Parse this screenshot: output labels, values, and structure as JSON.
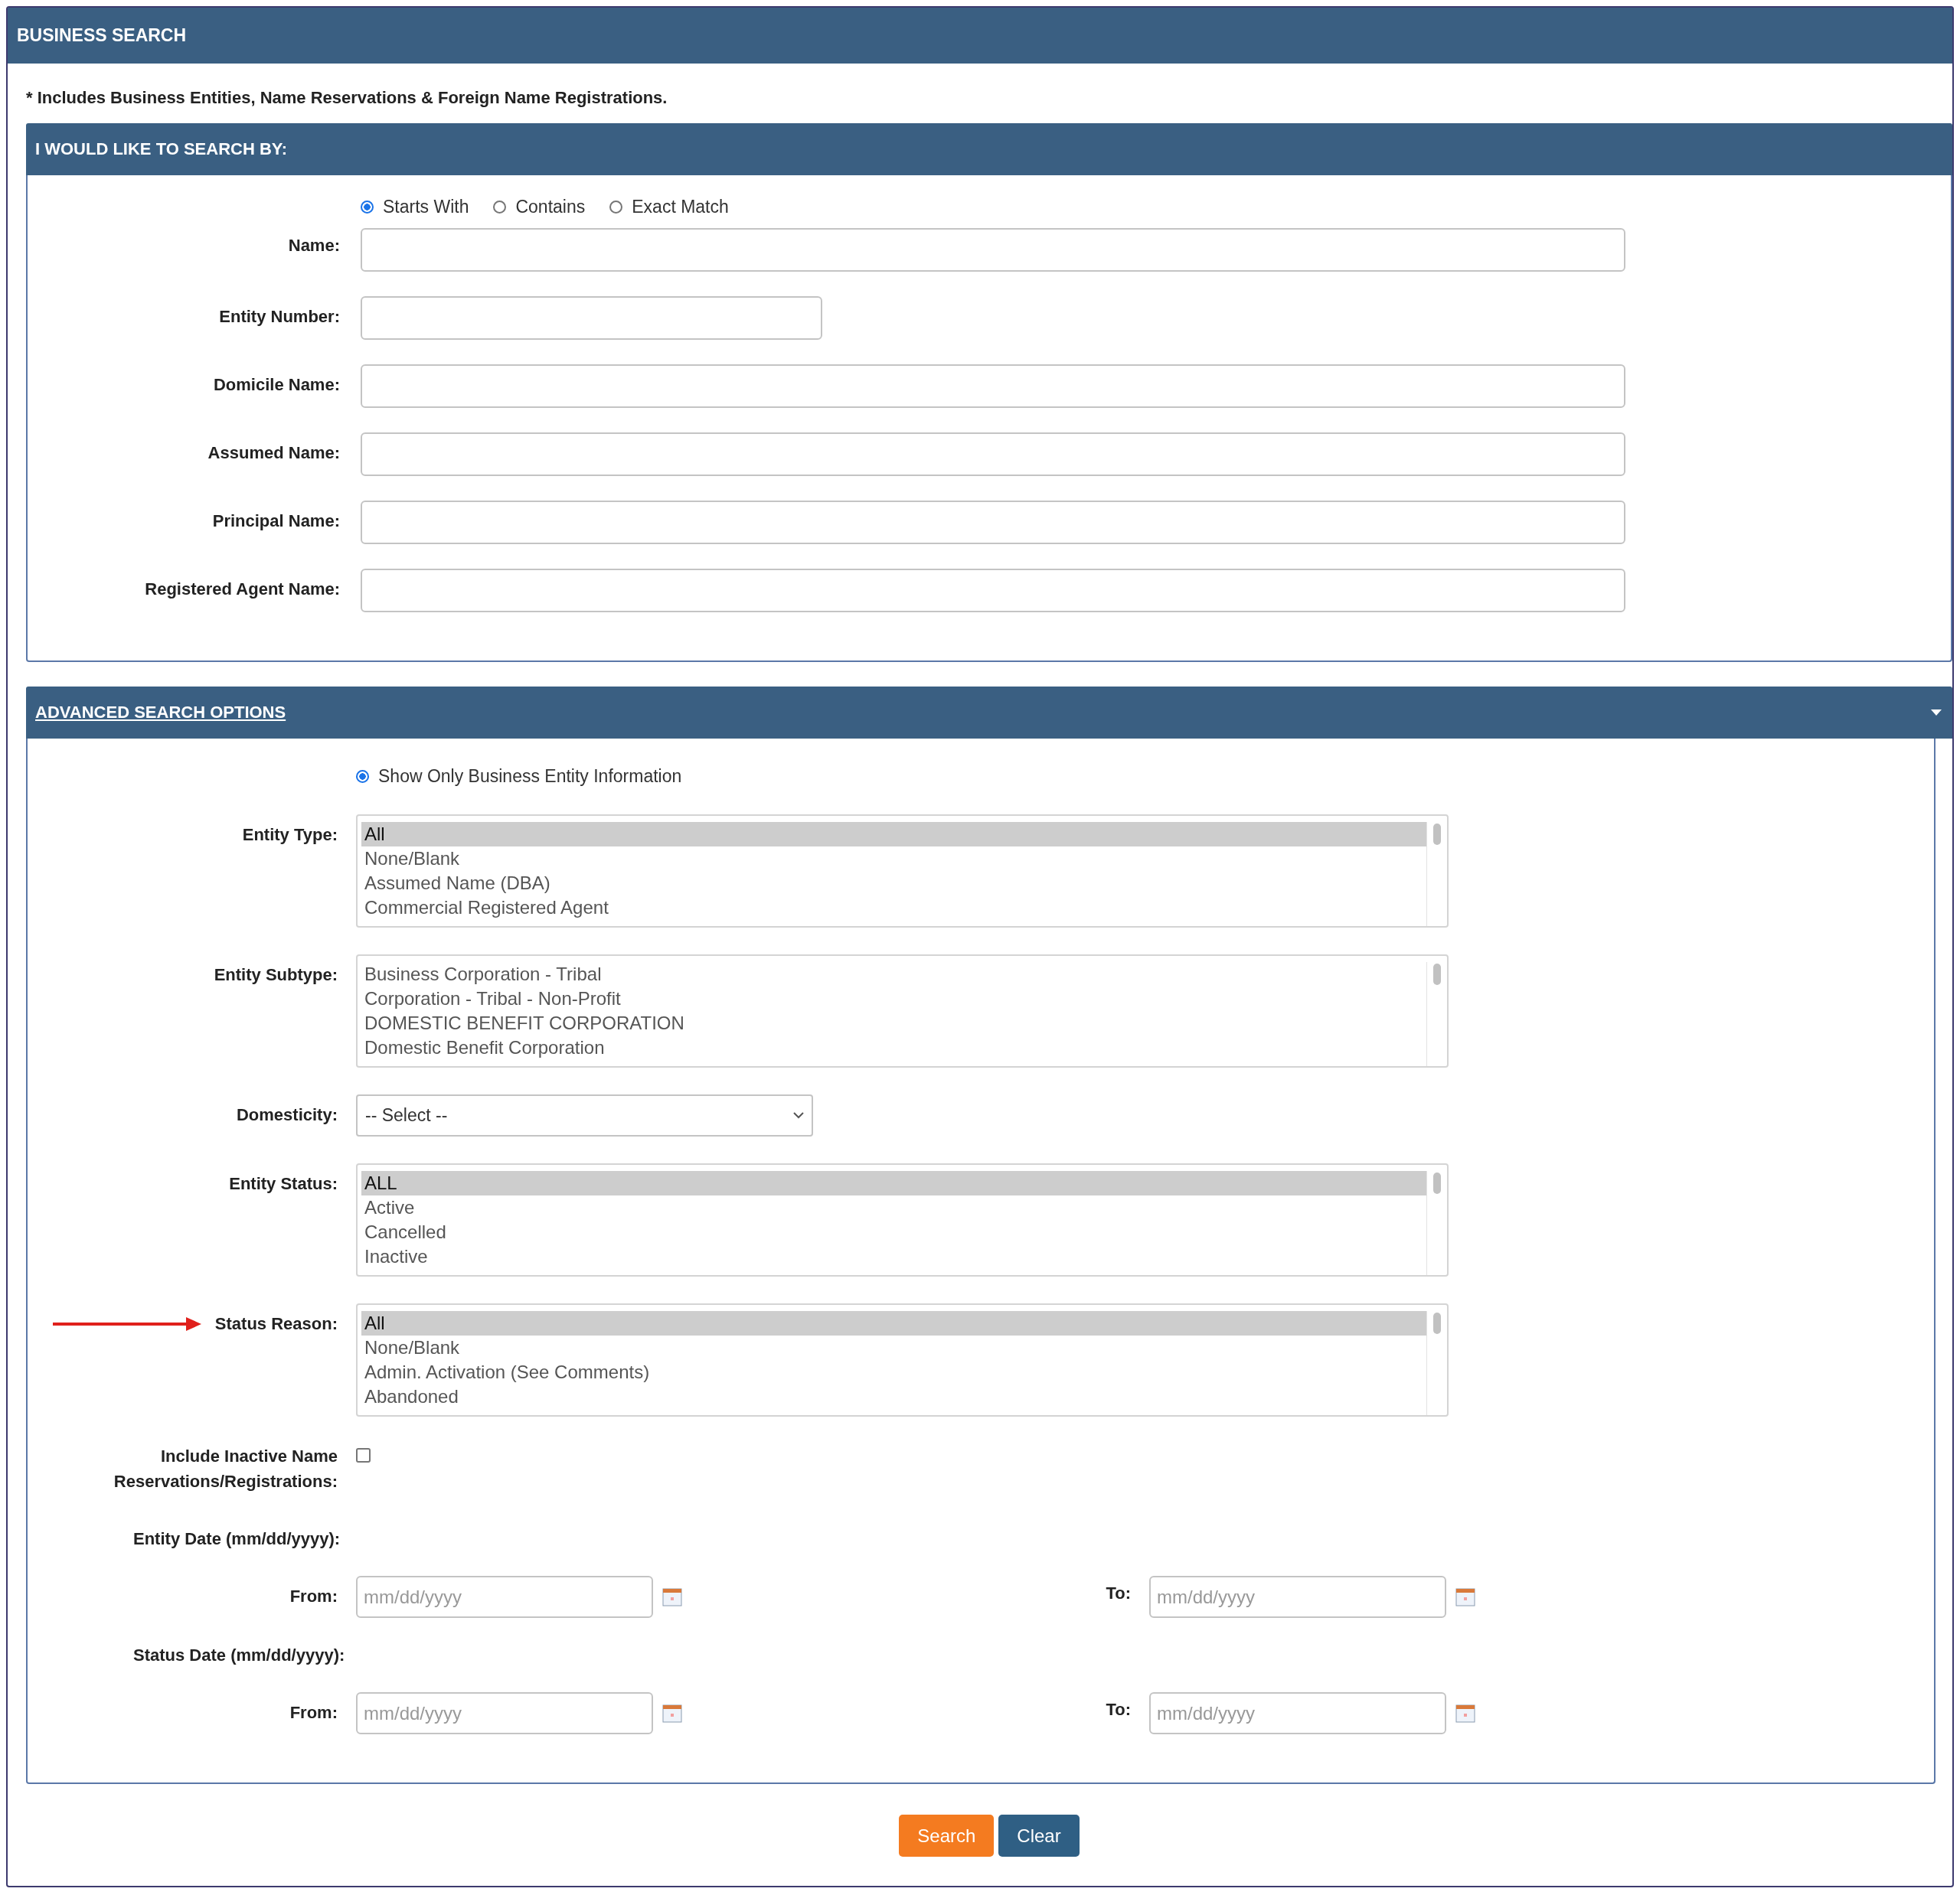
{
  "page": {
    "title": "BUSINESS SEARCH",
    "note": "* Includes Business Entities, Name Reservations & Foreign Name Registrations."
  },
  "search_by": {
    "title": "I WOULD LIKE TO SEARCH BY:",
    "match_options": [
      {
        "label": "Starts With",
        "selected": true
      },
      {
        "label": "Contains",
        "selected": false
      },
      {
        "label": "Exact Match",
        "selected": false
      }
    ],
    "fields": [
      {
        "label": "Name:",
        "kind": "wide"
      },
      {
        "label": "Entity Number:",
        "kind": "short"
      },
      {
        "label": "Domicile Name:",
        "kind": "wide"
      },
      {
        "label": "Assumed Name:",
        "kind": "wide"
      },
      {
        "label": "Principal Name:",
        "kind": "wide"
      },
      {
        "label": "Registered Agent Name:",
        "kind": "wide"
      }
    ]
  },
  "advanced": {
    "title": "ADVANCED SEARCH OPTIONS",
    "expanded": true,
    "display_option": {
      "label": "Show Only Business Entity Information",
      "selected": true
    },
    "rows": [
      {
        "kind": "listbox",
        "label": "Entity Type:",
        "annotated": false,
        "items": [
          {
            "label": "All",
            "selected": true
          },
          {
            "label": "None/Blank",
            "selected": false
          },
          {
            "label": "Assumed Name (DBA)",
            "selected": false
          },
          {
            "label": "Commercial Registered Agent",
            "selected": false
          }
        ]
      },
      {
        "kind": "listbox",
        "label": "Entity Subtype:",
        "annotated": false,
        "items": [
          {
            "label": "Business Corporation - Tribal",
            "selected": false
          },
          {
            "label": "Corporation - Tribal - Non-Profit",
            "selected": false
          },
          {
            "label": "DOMESTIC BENEFIT CORPORATION",
            "selected": false
          },
          {
            "label": "Domestic Benefit Corporation",
            "selected": false
          }
        ]
      },
      {
        "kind": "select",
        "label": "Domesticity:",
        "value": "-- Select --"
      },
      {
        "kind": "listbox",
        "label": "Entity Status:",
        "annotated": false,
        "items": [
          {
            "label": "ALL",
            "selected": true
          },
          {
            "label": "Active",
            "selected": false
          },
          {
            "label": "Cancelled",
            "selected": false
          },
          {
            "label": "Inactive",
            "selected": false
          }
        ]
      },
      {
        "kind": "listbox",
        "label": "Status Reason:",
        "annotated": true,
        "items": [
          {
            "label": "All",
            "selected": true
          },
          {
            "label": "None/Blank",
            "selected": false
          },
          {
            "label": "Admin. Activation (See Comments)",
            "selected": false
          },
          {
            "label": "Abandoned",
            "selected": false
          }
        ]
      },
      {
        "kind": "checkbox",
        "label": "Include Inactive Name Reservations/Registrations:",
        "checked": false
      },
      {
        "kind": "heading",
        "label": "Entity Date (mm/dd/yyyy):"
      },
      {
        "kind": "date_range",
        "from_label": "From:",
        "from_placeholder": "mm/dd/yyyy",
        "to_label": "To:",
        "to_placeholder": "mm/dd/yyyy"
      },
      {
        "kind": "heading",
        "label": "Status Date (mm/dd/yyyy):"
      },
      {
        "kind": "date_range",
        "from_label": "From:",
        "from_placeholder": "mm/dd/yyyy",
        "to_label": "To:",
        "to_placeholder": "mm/dd/yyyy"
      }
    ]
  },
  "buttons": [
    {
      "label": "Search",
      "kind": "primary"
    },
    {
      "label": "Clear",
      "kind": "secondary"
    }
  ]
}
